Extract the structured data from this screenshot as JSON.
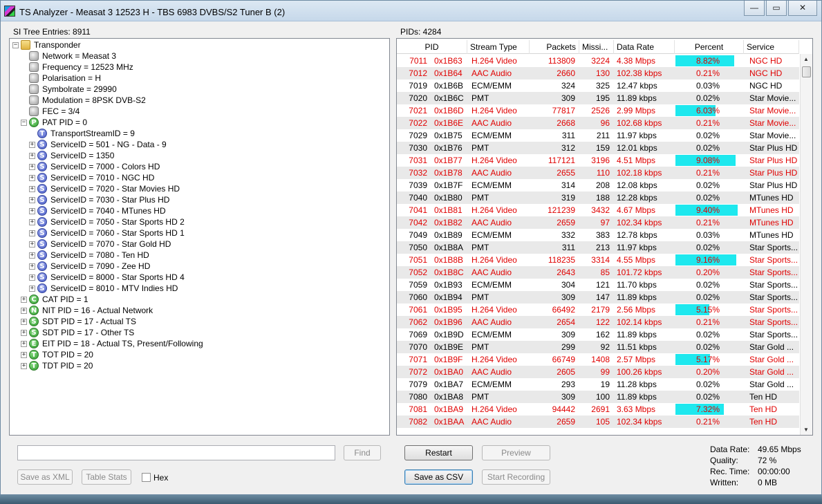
{
  "window": {
    "title": "TS Analyzer - Measat 3 12523 H - TBS 6983 DVBS/S2 Tuner B (2)",
    "minimize": "—",
    "maximize": "▭",
    "close": "✕"
  },
  "tree": {
    "header": "SI Tree Entries: 8911",
    "rows": [
      {
        "label": "Transponder",
        "icon": "folder",
        "letter": "",
        "expander": "−"
      },
      {
        "label": "Network = Measat 3",
        "icon": "gray",
        "letter": "",
        "expander": ""
      },
      {
        "label": "Frequency = 12523 MHz",
        "icon": "gray",
        "letter": "",
        "expander": ""
      },
      {
        "label": "Polarisation = H",
        "icon": "gray",
        "letter": "",
        "expander": ""
      },
      {
        "label": "Symbolrate = 29990",
        "icon": "gray",
        "letter": "",
        "expander": ""
      },
      {
        "label": "Modulation = 8PSK DVB-S2",
        "icon": "gray",
        "letter": "",
        "expander": ""
      },
      {
        "label": "FEC = 3/4",
        "icon": "gray",
        "letter": "",
        "expander": ""
      },
      {
        "label": "PAT PID = 0",
        "icon": "green",
        "letter": "P",
        "expander": "−"
      },
      {
        "label": "TransportStreamID = 9",
        "icon": "blue",
        "letter": "T",
        "expander": ""
      },
      {
        "label": "ServiceID = 501 - NG - Data - 9",
        "icon": "blue",
        "letter": "S",
        "expander": "+"
      },
      {
        "label": "ServiceID = 1350",
        "icon": "blue",
        "letter": "S",
        "expander": "+"
      },
      {
        "label": "ServiceID = 7000 - Colors HD",
        "icon": "blue",
        "letter": "S",
        "expander": "+"
      },
      {
        "label": "ServiceID = 7010 - NGC HD",
        "icon": "blue",
        "letter": "S",
        "expander": "+"
      },
      {
        "label": "ServiceID = 7020 - Star Movies HD",
        "icon": "blue",
        "letter": "S",
        "expander": "+"
      },
      {
        "label": "ServiceID = 7030 - Star Plus HD",
        "icon": "blue",
        "letter": "S",
        "expander": "+"
      },
      {
        "label": "ServiceID = 7040 - MTunes HD",
        "icon": "blue",
        "letter": "S",
        "expander": "+"
      },
      {
        "label": "ServiceID = 7050 - Star Sports HD 2",
        "icon": "blue",
        "letter": "S",
        "expander": "+"
      },
      {
        "label": "ServiceID = 7060 - Star Sports HD 1",
        "icon": "blue",
        "letter": "S",
        "expander": "+"
      },
      {
        "label": "ServiceID = 7070 - Star Gold HD",
        "icon": "blue",
        "letter": "S",
        "expander": "+"
      },
      {
        "label": "ServiceID = 7080 - Ten HD",
        "icon": "blue",
        "letter": "S",
        "expander": "+"
      },
      {
        "label": "ServiceID = 7090 - Zee HD",
        "icon": "blue",
        "letter": "S",
        "expander": "+"
      },
      {
        "label": "ServiceID = 8000 - Star Sports HD 4",
        "icon": "blue",
        "letter": "S",
        "expander": "+"
      },
      {
        "label": "ServiceID = 8010 - MTV Indies HD",
        "icon": "blue",
        "letter": "S",
        "expander": "+"
      },
      {
        "label": "CAT PID = 1",
        "icon": "green",
        "letter": "C",
        "expander": "+"
      },
      {
        "label": "NIT PID = 16 - Actual Network",
        "icon": "green",
        "letter": "N",
        "expander": "+"
      },
      {
        "label": "SDT PID = 17 - Actual TS",
        "icon": "green",
        "letter": "S",
        "expander": "+"
      },
      {
        "label": "SDT PID = 17 - Other TS",
        "icon": "green",
        "letter": "S",
        "expander": "+"
      },
      {
        "label": "EIT PID = 18 - Actual TS, Present/Following",
        "icon": "green",
        "letter": "E",
        "expander": "+"
      },
      {
        "label": "TOT PID = 20",
        "icon": "green",
        "letter": "T",
        "expander": "+"
      },
      {
        "label": "TDT PID = 20",
        "icon": "green",
        "letter": "T",
        "expander": "+"
      }
    ]
  },
  "pids": {
    "header": "PIDs: 4284",
    "columns": [
      "PID",
      "Stream Type",
      "Packets",
      "Missi...",
      "Data Rate",
      "Percent",
      "Service"
    ],
    "bar_color": "#1ee8ee",
    "rows": [
      {
        "dec": "7011",
        "hex": "0x1B63",
        "type": "H.264 Video",
        "packets": "113809",
        "missing": "3224",
        "rate": "4.38 Mbps",
        "percent": "8.82%",
        "pct": 8.82,
        "service": "NGC HD",
        "red": true
      },
      {
        "dec": "7012",
        "hex": "0x1B64",
        "type": "AAC Audio",
        "packets": "2660",
        "missing": "130",
        "rate": "102.38 kbps",
        "percent": "0.21%",
        "pct": 0.21,
        "service": "NGC HD",
        "red": true
      },
      {
        "dec": "7019",
        "hex": "0x1B6B",
        "type": "ECM/EMM",
        "packets": "324",
        "missing": "325",
        "rate": "12.47 kbps",
        "percent": "0.03%",
        "pct": 0,
        "service": "NGC HD",
        "red": false
      },
      {
        "dec": "7020",
        "hex": "0x1B6C",
        "type": "PMT",
        "packets": "309",
        "missing": "195",
        "rate": "11.89 kbps",
        "percent": "0.02%",
        "pct": 0,
        "service": "Star Movie...",
        "red": false
      },
      {
        "dec": "7021",
        "hex": "0x1B6D",
        "type": "H.264 Video",
        "packets": "77817",
        "missing": "2526",
        "rate": "2.99 Mbps",
        "percent": "6.03%",
        "pct": 6.03,
        "service": "Star Movie...",
        "red": true
      },
      {
        "dec": "7022",
        "hex": "0x1B6E",
        "type": "AAC Audio",
        "packets": "2668",
        "missing": "96",
        "rate": "102.68 kbps",
        "percent": "0.21%",
        "pct": 0.21,
        "service": "Star Movie...",
        "red": true
      },
      {
        "dec": "7029",
        "hex": "0x1B75",
        "type": "ECM/EMM",
        "packets": "311",
        "missing": "211",
        "rate": "11.97 kbps",
        "percent": "0.02%",
        "pct": 0,
        "service": "Star Movie...",
        "red": false
      },
      {
        "dec": "7030",
        "hex": "0x1B76",
        "type": "PMT",
        "packets": "312",
        "missing": "159",
        "rate": "12.01 kbps",
        "percent": "0.02%",
        "pct": 0,
        "service": "Star Plus HD",
        "red": false
      },
      {
        "dec": "7031",
        "hex": "0x1B77",
        "type": "H.264 Video",
        "packets": "117121",
        "missing": "3196",
        "rate": "4.51 Mbps",
        "percent": "9.08%",
        "pct": 9.08,
        "service": "Star Plus HD",
        "red": true
      },
      {
        "dec": "7032",
        "hex": "0x1B78",
        "type": "AAC Audio",
        "packets": "2655",
        "missing": "110",
        "rate": "102.18 kbps",
        "percent": "0.21%",
        "pct": 0.21,
        "service": "Star Plus HD",
        "red": true
      },
      {
        "dec": "7039",
        "hex": "0x1B7F",
        "type": "ECM/EMM",
        "packets": "314",
        "missing": "208",
        "rate": "12.08 kbps",
        "percent": "0.02%",
        "pct": 0,
        "service": "Star Plus HD",
        "red": false
      },
      {
        "dec": "7040",
        "hex": "0x1B80",
        "type": "PMT",
        "packets": "319",
        "missing": "188",
        "rate": "12.28 kbps",
        "percent": "0.02%",
        "pct": 0,
        "service": "MTunes HD",
        "red": false
      },
      {
        "dec": "7041",
        "hex": "0x1B81",
        "type": "H.264 Video",
        "packets": "121239",
        "missing": "3432",
        "rate": "4.67 Mbps",
        "percent": "9.40%",
        "pct": 9.4,
        "service": "MTunes HD",
        "red": true
      },
      {
        "dec": "7042",
        "hex": "0x1B82",
        "type": "AAC Audio",
        "packets": "2659",
        "missing": "97",
        "rate": "102.34 kbps",
        "percent": "0.21%",
        "pct": 0.21,
        "service": "MTunes HD",
        "red": true
      },
      {
        "dec": "7049",
        "hex": "0x1B89",
        "type": "ECM/EMM",
        "packets": "332",
        "missing": "383",
        "rate": "12.78 kbps",
        "percent": "0.03%",
        "pct": 0,
        "service": "MTunes HD",
        "red": false
      },
      {
        "dec": "7050",
        "hex": "0x1B8A",
        "type": "PMT",
        "packets": "311",
        "missing": "213",
        "rate": "11.97 kbps",
        "percent": "0.02%",
        "pct": 0,
        "service": "Star Sports...",
        "red": false
      },
      {
        "dec": "7051",
        "hex": "0x1B8B",
        "type": "H.264 Video",
        "packets": "118235",
        "missing": "3314",
        "rate": "4.55 Mbps",
        "percent": "9.16%",
        "pct": 9.16,
        "service": "Star Sports...",
        "red": true
      },
      {
        "dec": "7052",
        "hex": "0x1B8C",
        "type": "AAC Audio",
        "packets": "2643",
        "missing": "85",
        "rate": "101.72 kbps",
        "percent": "0.20%",
        "pct": 0.2,
        "service": "Star Sports...",
        "red": true
      },
      {
        "dec": "7059",
        "hex": "0x1B93",
        "type": "ECM/EMM",
        "packets": "304",
        "missing": "121",
        "rate": "11.70 kbps",
        "percent": "0.02%",
        "pct": 0,
        "service": "Star Sports...",
        "red": false
      },
      {
        "dec": "7060",
        "hex": "0x1B94",
        "type": "PMT",
        "packets": "309",
        "missing": "147",
        "rate": "11.89 kbps",
        "percent": "0.02%",
        "pct": 0,
        "service": "Star Sports...",
        "red": false
      },
      {
        "dec": "7061",
        "hex": "0x1B95",
        "type": "H.264 Video",
        "packets": "66492",
        "missing": "2179",
        "rate": "2.56 Mbps",
        "percent": "5.15%",
        "pct": 5.15,
        "service": "Star Sports...",
        "red": true
      },
      {
        "dec": "7062",
        "hex": "0x1B96",
        "type": "AAC Audio",
        "packets": "2654",
        "missing": "122",
        "rate": "102.14 kbps",
        "percent": "0.21%",
        "pct": 0.21,
        "service": "Star Sports...",
        "red": true
      },
      {
        "dec": "7069",
        "hex": "0x1B9D",
        "type": "ECM/EMM",
        "packets": "309",
        "missing": "162",
        "rate": "11.89 kbps",
        "percent": "0.02%",
        "pct": 0,
        "service": "Star Sports...",
        "red": false
      },
      {
        "dec": "7070",
        "hex": "0x1B9E",
        "type": "PMT",
        "packets": "299",
        "missing": "92",
        "rate": "11.51 kbps",
        "percent": "0.02%",
        "pct": 0,
        "service": "Star Gold ...",
        "red": false
      },
      {
        "dec": "7071",
        "hex": "0x1B9F",
        "type": "H.264 Video",
        "packets": "66749",
        "missing": "1408",
        "rate": "2.57 Mbps",
        "percent": "5.17%",
        "pct": 5.17,
        "service": "Star Gold ...",
        "red": true
      },
      {
        "dec": "7072",
        "hex": "0x1BA0",
        "type": "AAC Audio",
        "packets": "2605",
        "missing": "99",
        "rate": "100.26 kbps",
        "percent": "0.20%",
        "pct": 0.2,
        "service": "Star Gold ...",
        "red": true
      },
      {
        "dec": "7079",
        "hex": "0x1BA7",
        "type": "ECM/EMM",
        "packets": "293",
        "missing": "19",
        "rate": "11.28 kbps",
        "percent": "0.02%",
        "pct": 0,
        "service": "Star Gold ...",
        "red": false
      },
      {
        "dec": "7080",
        "hex": "0x1BA8",
        "type": "PMT",
        "packets": "309",
        "missing": "100",
        "rate": "11.89 kbps",
        "percent": "0.02%",
        "pct": 0,
        "service": "Ten HD",
        "red": false
      },
      {
        "dec": "7081",
        "hex": "0x1BA9",
        "type": "H.264 Video",
        "packets": "94442",
        "missing": "2691",
        "rate": "3.63 Mbps",
        "percent": "7.32%",
        "pct": 7.32,
        "service": "Ten HD",
        "red": true
      },
      {
        "dec": "7082",
        "hex": "0x1BAA",
        "type": "AAC Audio",
        "packets": "2659",
        "missing": "105",
        "rate": "102.34 kbps",
        "percent": "0.21%",
        "pct": 0.21,
        "service": "Ten HD",
        "red": true
      }
    ]
  },
  "controls": {
    "find_label": "Find",
    "save_xml_label": "Save as XML",
    "table_stats_label": "Table Stats",
    "hex_label": "Hex",
    "restart_label": "Restart",
    "preview_label": "Preview",
    "save_csv_label": "Save as CSV",
    "start_recording_label": "Start Recording"
  },
  "stats": [
    {
      "key": "Data Rate:",
      "value": "49.65 Mbps"
    },
    {
      "key": "Quality:",
      "value": "72 %"
    },
    {
      "key": "Rec. Time:",
      "value": "00:00:00"
    },
    {
      "key": "Written:",
      "value": "0 MB"
    }
  ]
}
